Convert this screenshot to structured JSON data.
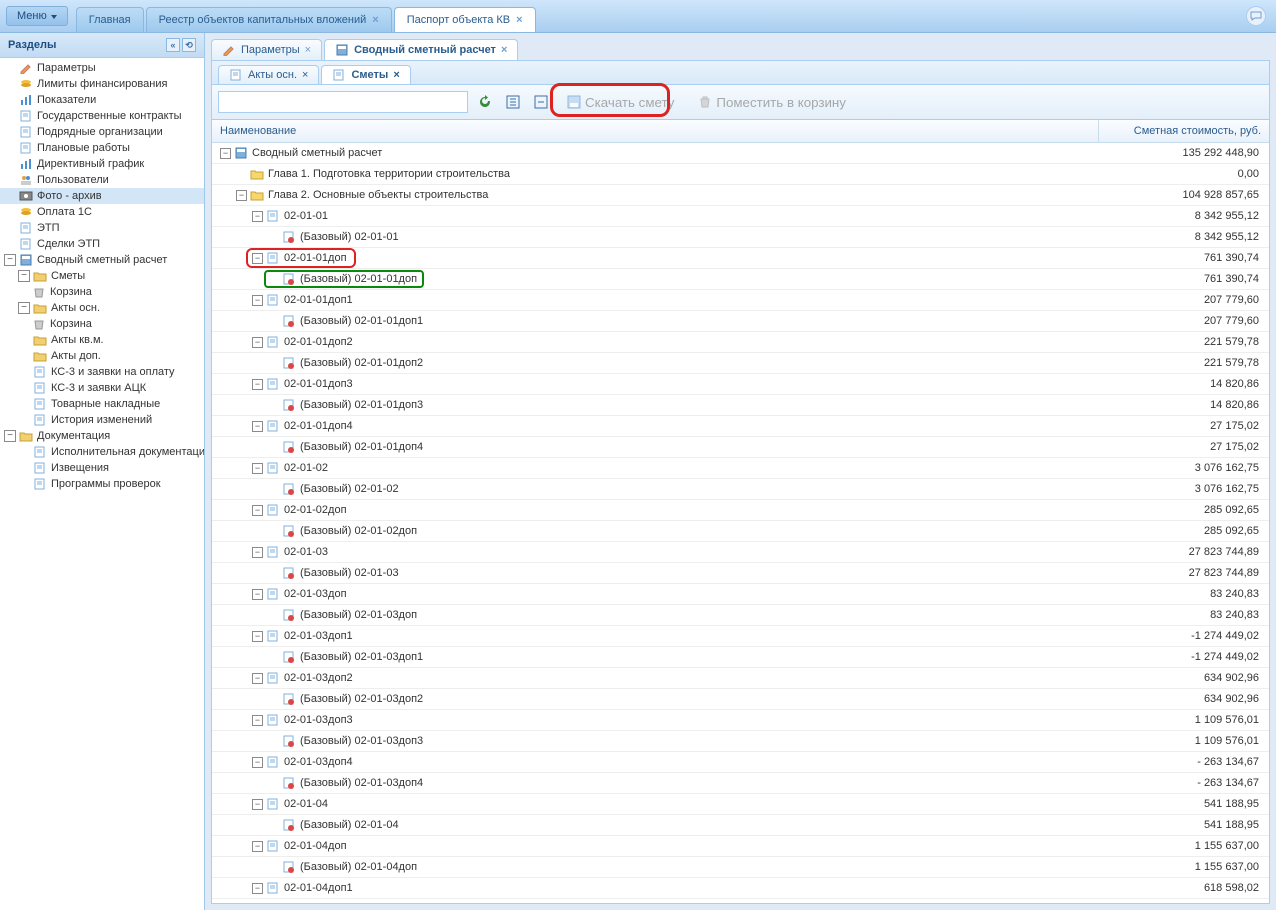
{
  "header": {
    "menu_label": "Меню",
    "tabs": [
      {
        "label": "Главная",
        "closable": false,
        "active": false
      },
      {
        "label": "Реестр объектов капитальных вложений",
        "closable": true,
        "active": false
      },
      {
        "label": "Паспорт объекта КВ",
        "closable": true,
        "active": true
      }
    ]
  },
  "sidebar": {
    "title": "Разделы",
    "items": [
      {
        "label": "Параметры",
        "icon": "pencil",
        "indent": 0
      },
      {
        "label": "Лимиты финансирования",
        "icon": "coins",
        "indent": 0
      },
      {
        "label": "Показатели",
        "icon": "chart",
        "indent": 0
      },
      {
        "label": "Государственные контракты",
        "icon": "doc",
        "indent": 0
      },
      {
        "label": "Подрядные организации",
        "icon": "doc",
        "indent": 0
      },
      {
        "label": "Плановые работы",
        "icon": "doc",
        "indent": 0
      },
      {
        "label": "Директивный график",
        "icon": "chart",
        "indent": 0
      },
      {
        "label": "Пользователи",
        "icon": "users",
        "indent": 0
      },
      {
        "label": "Фото - архив",
        "icon": "photo",
        "indent": 0,
        "selected": true
      },
      {
        "label": "Оплата 1С",
        "icon": "coins",
        "indent": 0
      },
      {
        "label": "ЭТП",
        "icon": "doc",
        "indent": 0
      },
      {
        "label": "Сделки ЭТП",
        "icon": "doc",
        "indent": 0
      },
      {
        "label": "Сводный сметный расчет",
        "icon": "calc",
        "indent": 0,
        "toggle": "-"
      },
      {
        "label": "Сметы",
        "icon": "folder",
        "indent": 1,
        "toggle": "-"
      },
      {
        "label": "Корзина",
        "icon": "trash",
        "indent": 2
      },
      {
        "label": "Акты осн.",
        "icon": "folder",
        "indent": 1,
        "toggle": "-"
      },
      {
        "label": "Корзина",
        "icon": "trash",
        "indent": 2
      },
      {
        "label": "Акты кв.м.",
        "icon": "folder",
        "indent": 1
      },
      {
        "label": "Акты доп.",
        "icon": "folder",
        "indent": 1
      },
      {
        "label": "КС-3 и заявки на оплату",
        "icon": "doc",
        "indent": 1
      },
      {
        "label": "КС-3 и заявки АЦК",
        "icon": "doc",
        "indent": 1
      },
      {
        "label": "Товарные накладные",
        "icon": "doc",
        "indent": 1
      },
      {
        "label": "История изменений",
        "icon": "doc",
        "indent": 1
      },
      {
        "label": "Документация",
        "icon": "folder",
        "indent": 0,
        "toggle": "-"
      },
      {
        "label": "Исполнительная документация",
        "icon": "doc",
        "indent": 1
      },
      {
        "label": "Извещения",
        "icon": "doc",
        "indent": 1
      },
      {
        "label": "Программы проверок",
        "icon": "doc",
        "indent": 1
      }
    ]
  },
  "content": {
    "tabs1": [
      {
        "label": "Параметры",
        "icon": "pencil",
        "active": false
      },
      {
        "label": "Сводный сметный расчет",
        "icon": "calc",
        "active": true
      }
    ],
    "tabs2": [
      {
        "label": "Акты осн.",
        "icon": "doc",
        "active": false
      },
      {
        "label": "Сметы",
        "icon": "doc",
        "active": true
      }
    ],
    "toolbar": {
      "download_label": "Скачать смету",
      "trash_label": "Поместить в корзину"
    },
    "grid": {
      "col_name": "Наименование",
      "col_cost": "Сметная стоимость, руб.",
      "rows": [
        {
          "indent": 0,
          "toggle": "▾",
          "icon": "calc",
          "label": "Сводный сметный расчет",
          "cost": "135 292 448,90"
        },
        {
          "indent": 1,
          "toggle": "",
          "icon": "folder-y",
          "label": "Глава 1. Подготовка территории строительства",
          "cost": "0,00"
        },
        {
          "indent": 1,
          "toggle": "▾",
          "icon": "folder-y",
          "label": "Глава 2. Основные объекты строительства",
          "cost": "104 928 857,65"
        },
        {
          "indent": 2,
          "toggle": "▾",
          "icon": "doc",
          "label": "02-01-01",
          "cost": "8 342 955,12"
        },
        {
          "indent": 3,
          "toggle": "",
          "icon": "doc-r",
          "label": "(Базовый) 02-01-01",
          "cost": "8 342 955,12"
        },
        {
          "indent": 2,
          "toggle": "▾",
          "icon": "doc",
          "label": "02-01-01доп",
          "cost": "761 390,74",
          "red": true
        },
        {
          "indent": 3,
          "toggle": "",
          "icon": "doc-r",
          "label": "(Базовый) 02-01-01доп",
          "cost": "761 390,74",
          "green": true
        },
        {
          "indent": 2,
          "toggle": "▾",
          "icon": "doc",
          "label": "02-01-01доп1",
          "cost": "207 779,60"
        },
        {
          "indent": 3,
          "toggle": "",
          "icon": "doc-r",
          "label": "(Базовый) 02-01-01доп1",
          "cost": "207 779,60"
        },
        {
          "indent": 2,
          "toggle": "▾",
          "icon": "doc",
          "label": "02-01-01доп2",
          "cost": "221 579,78"
        },
        {
          "indent": 3,
          "toggle": "",
          "icon": "doc-r",
          "label": "(Базовый) 02-01-01доп2",
          "cost": "221 579,78"
        },
        {
          "indent": 2,
          "toggle": "▾",
          "icon": "doc",
          "label": "02-01-01доп3",
          "cost": "14 820,86"
        },
        {
          "indent": 3,
          "toggle": "",
          "icon": "doc-r",
          "label": "(Базовый) 02-01-01доп3",
          "cost": "14 820,86"
        },
        {
          "indent": 2,
          "toggle": "▾",
          "icon": "doc",
          "label": "02-01-01доп4",
          "cost": "27 175,02"
        },
        {
          "indent": 3,
          "toggle": "",
          "icon": "doc-r",
          "label": "(Базовый) 02-01-01доп4",
          "cost": "27 175,02"
        },
        {
          "indent": 2,
          "toggle": "▾",
          "icon": "doc",
          "label": "02-01-02",
          "cost": "3 076 162,75"
        },
        {
          "indent": 3,
          "toggle": "",
          "icon": "doc-r",
          "label": "(Базовый) 02-01-02",
          "cost": "3 076 162,75"
        },
        {
          "indent": 2,
          "toggle": "▾",
          "icon": "doc",
          "label": "02-01-02доп",
          "cost": "285 092,65"
        },
        {
          "indent": 3,
          "toggle": "",
          "icon": "doc-r",
          "label": "(Базовый) 02-01-02доп",
          "cost": "285 092,65"
        },
        {
          "indent": 2,
          "toggle": "▾",
          "icon": "doc",
          "label": "02-01-03",
          "cost": "27 823 744,89"
        },
        {
          "indent": 3,
          "toggle": "",
          "icon": "doc-r",
          "label": "(Базовый) 02-01-03",
          "cost": "27 823 744,89"
        },
        {
          "indent": 2,
          "toggle": "▾",
          "icon": "doc",
          "label": "02-01-03доп",
          "cost": "83 240,83"
        },
        {
          "indent": 3,
          "toggle": "",
          "icon": "doc-r",
          "label": "(Базовый) 02-01-03доп",
          "cost": "83 240,83"
        },
        {
          "indent": 2,
          "toggle": "▾",
          "icon": "doc",
          "label": "02-01-03доп1",
          "cost": "-1 274 449,02"
        },
        {
          "indent": 3,
          "toggle": "",
          "icon": "doc-r",
          "label": "(Базовый) 02-01-03доп1",
          "cost": "-1 274 449,02"
        },
        {
          "indent": 2,
          "toggle": "▾",
          "icon": "doc",
          "label": "02-01-03доп2",
          "cost": "634 902,96"
        },
        {
          "indent": 3,
          "toggle": "",
          "icon": "doc-r",
          "label": "(Базовый) 02-01-03доп2",
          "cost": "634 902,96"
        },
        {
          "indent": 2,
          "toggle": "▾",
          "icon": "doc",
          "label": "02-01-03доп3",
          "cost": "1 109 576,01"
        },
        {
          "indent": 3,
          "toggle": "",
          "icon": "doc-r",
          "label": "(Базовый) 02-01-03доп3",
          "cost": "1 109 576,01"
        },
        {
          "indent": 2,
          "toggle": "▾",
          "icon": "doc",
          "label": "02-01-03доп4",
          "cost": "- 263 134,67"
        },
        {
          "indent": 3,
          "toggle": "",
          "icon": "doc-r",
          "label": "(Базовый) 02-01-03доп4",
          "cost": "- 263 134,67"
        },
        {
          "indent": 2,
          "toggle": "▾",
          "icon": "doc",
          "label": "02-01-04",
          "cost": "541 188,95"
        },
        {
          "indent": 3,
          "toggle": "",
          "icon": "doc-r",
          "label": "(Базовый) 02-01-04",
          "cost": "541 188,95"
        },
        {
          "indent": 2,
          "toggle": "▾",
          "icon": "doc",
          "label": "02-01-04доп",
          "cost": "1 155 637,00"
        },
        {
          "indent": 3,
          "toggle": "",
          "icon": "doc-r",
          "label": "(Базовый) 02-01-04доп",
          "cost": "1 155 637,00"
        },
        {
          "indent": 2,
          "toggle": "▾",
          "icon": "doc",
          "label": "02-01-04доп1",
          "cost": "618 598,02"
        }
      ]
    }
  }
}
